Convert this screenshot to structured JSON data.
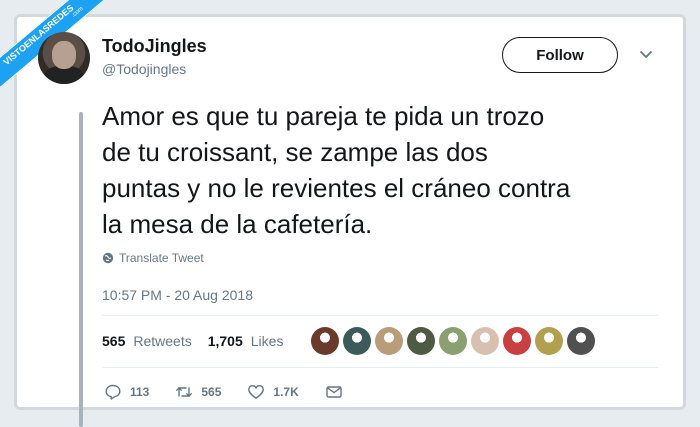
{
  "watermark": {
    "text": "VISTOENLASREDES",
    "sub": ".com"
  },
  "tweet": {
    "display_name": "TodoJingles",
    "handle": "@Todojingles",
    "follow_label": "Follow",
    "text": "Amor es que tu pareja te pida un trozo\nde tu croissant, se zampe las dos\npuntas y no le revientes el cráneo contra\nla mesa de la cafetería.",
    "translate_label": "Translate Tweet",
    "timestamp": "10:57 PM - 20 Aug 2018",
    "retweets_count": "565",
    "retweets_label": "Retweets",
    "likes_count": "1,705",
    "likes_label": "Likes",
    "liker_colors": [
      "#6a3b2a",
      "#3d5a5a",
      "#b99c7a",
      "#4d5a44",
      "#8aa070",
      "#d8c0b0",
      "#c84040",
      "#b0a050",
      "#505050"
    ],
    "actions": {
      "replies": "113",
      "retweets": "565",
      "likes": "1.7K"
    }
  },
  "colors": {
    "accent": "#1da1f2",
    "text": "#14171a",
    "muted": "#657786"
  }
}
